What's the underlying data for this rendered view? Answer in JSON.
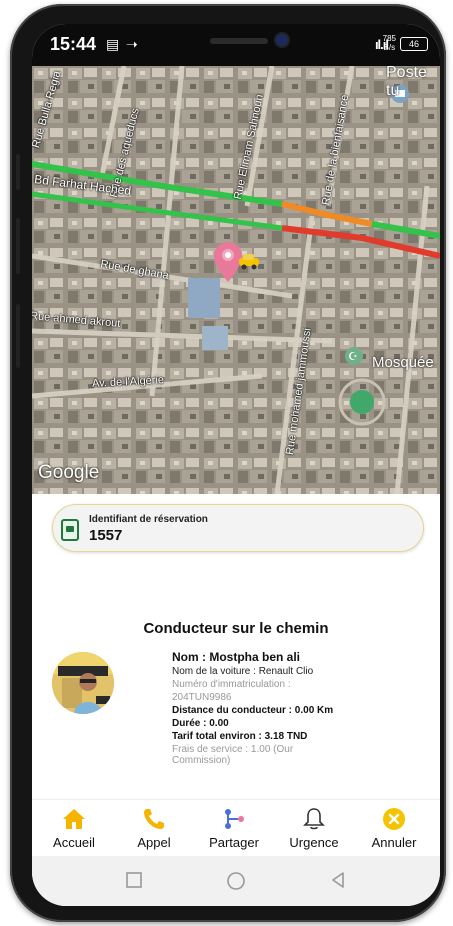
{
  "status_bar": {
    "time": "15:44",
    "signal": "ıl.ıl",
    "net_speed_value": "785",
    "net_speed_unit": "B/s",
    "battery": "46"
  },
  "map": {
    "labels": {
      "poste": "Poste tu",
      "rue_bulla_regia": "Rue Bulla Regia",
      "rue_des_aqueducs": "Rue des aqueducs",
      "rue_elimam_sahnoun": "Rue Elimam Sahnoun",
      "rue_de_la_bienfaisance": "Rue de la bienfaisance",
      "bd_farhat_hached": "Bd Farhat Hached",
      "rue_de_ghana": "Rue de ghana",
      "rue_ahmed_akrout": "Rue ahmed akrout",
      "av_algerie": "Av. de l'Algérie",
      "rue_mohamed_jammoussi": "Rue mohamed jammoussi",
      "mosquee": "Mosquée"
    },
    "google_logo": "Google"
  },
  "reservation": {
    "label": "Identifiant de réservation",
    "value": "1557"
  },
  "driver": {
    "section_title": "Conducteur sur le chemin",
    "name": "Nom : Mostpha ben ali",
    "car": "Nom de la voiture : Renault Clio",
    "plate_label": "Numéro d'immatriculation :",
    "plate_value": "204TUN9986",
    "distance": "Distance du conducteur : 0.00 Km",
    "duration": "Durée : 0.00",
    "total_fare": "Tarif total environ : 3.18 TND",
    "service_fee": "Frais de service : 1.00 (Our Commission)"
  },
  "bottom_nav": {
    "items": [
      {
        "label": "Accueil",
        "icon": "home-icon",
        "color": "#f5b400"
      },
      {
        "label": "Appel",
        "icon": "phone-icon",
        "color": "#f5b400"
      },
      {
        "label": "Partager",
        "icon": "share-icon",
        "color": "#4a6fd8"
      },
      {
        "label": "Urgence",
        "icon": "bell-icon",
        "color": "#333333"
      },
      {
        "label": "Annuler",
        "icon": "cancel-icon",
        "color": "#f5c400"
      }
    ]
  },
  "colors": {
    "accent": "#f5b400",
    "map_pin": "#e8799a",
    "route_green": "#33c24a",
    "route_orange": "#f08a24",
    "route_red": "#e03b2b"
  }
}
